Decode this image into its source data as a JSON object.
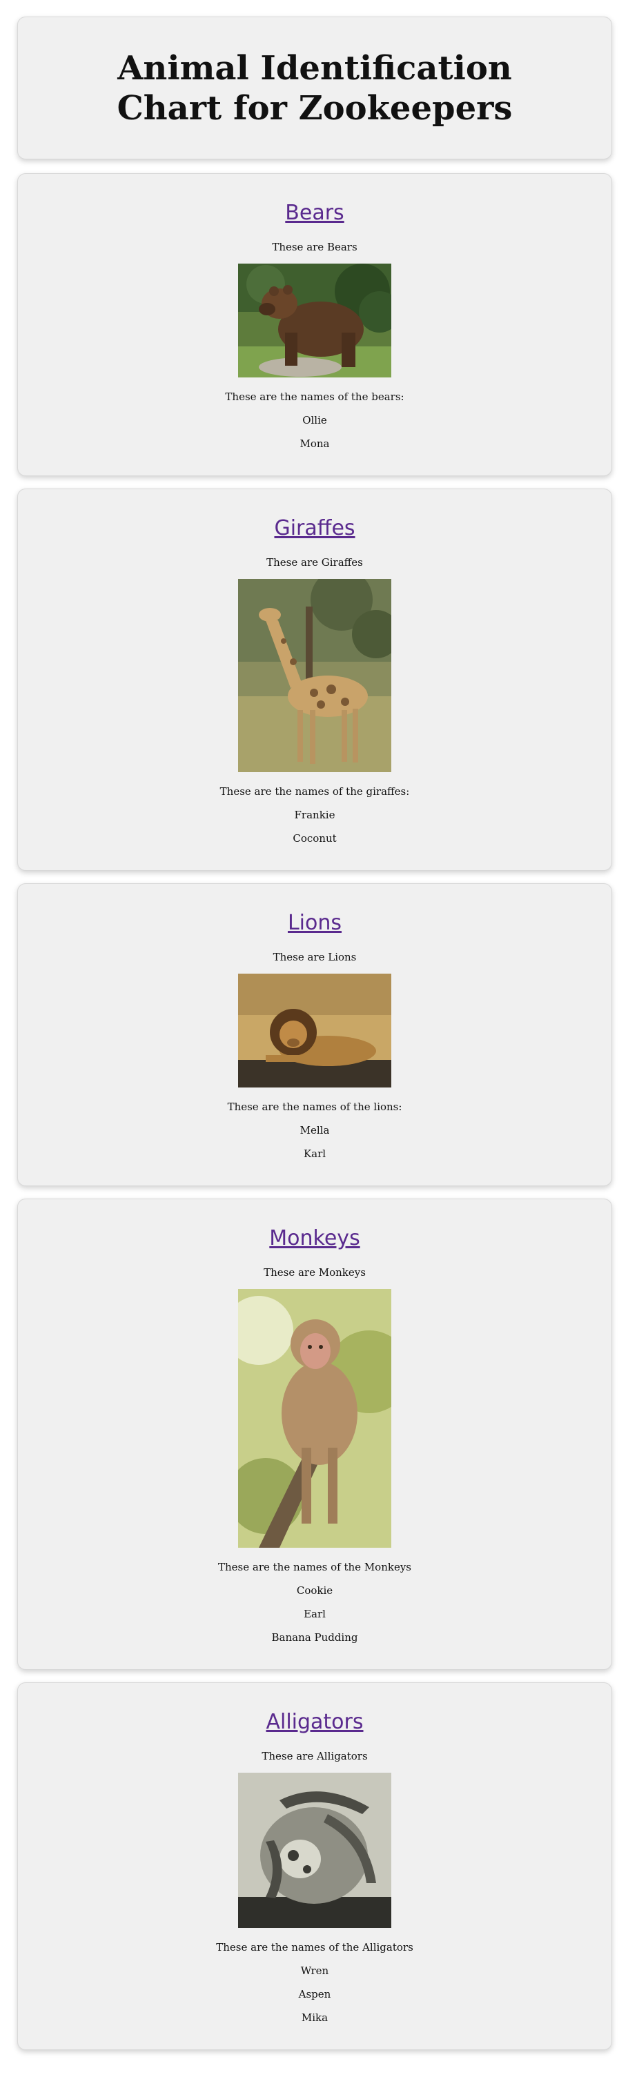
{
  "page_title": "Animal Identification Chart for Zookeepers",
  "animals": [
    {
      "heading": "Bears",
      "caption": "These are Bears",
      "names_intro": "These are the names of the bears:",
      "names": [
        "Ollie",
        "Mona"
      ]
    },
    {
      "heading": "Giraffes",
      "caption": "These are Giraffes",
      "names_intro": "These are the names of the giraffes:",
      "names": [
        "Frankie",
        "Coconut"
      ]
    },
    {
      "heading": "Lions",
      "caption": "These are Lions",
      "names_intro": "These are the names of the lions:",
      "names": [
        "Mella",
        "Karl"
      ]
    },
    {
      "heading": "Monkeys",
      "caption": "These are Monkeys",
      "names_intro": "These are the names of the Monkeys",
      "names": [
        "Cookie",
        "Earl",
        "Banana Pudding"
      ]
    },
    {
      "heading": "Alligators",
      "caption": "These are Alligators",
      "names_intro": "These are the names of the Alligators",
      "names": [
        "Wren",
        "Aspen",
        "Mika"
      ]
    }
  ],
  "colors": {
    "card_background": "#f0f0f0",
    "link": "#5a2a8e"
  }
}
